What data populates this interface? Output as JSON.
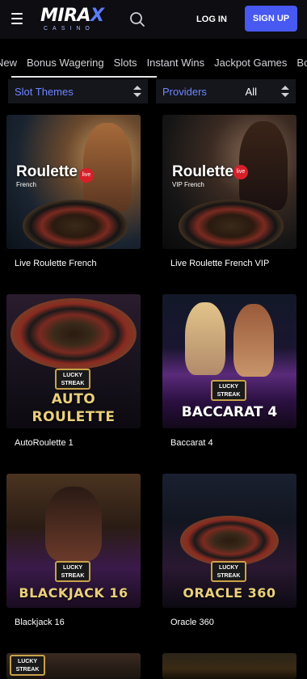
{
  "header": {
    "logo_main_a": "MIRA",
    "logo_main_x": "X",
    "logo_sub": "CASINO",
    "login_label": "LOG IN",
    "signup_label": "SIGN UP",
    "menu_icon": "hamburger-icon",
    "search_icon": "search-icon",
    "accent_color": "#4759f0"
  },
  "categories": [
    "New",
    "Bonus Wagering",
    "Slots",
    "Instant Wins",
    "Jackpot Games",
    "Bo"
  ],
  "filters": {
    "themes_label": "Slot Themes",
    "providers_label": "Providers",
    "providers_value": "All"
  },
  "games": [
    {
      "title": "Live Roulette French",
      "art_title": "Roulette",
      "art_sub": "French",
      "badge": "live"
    },
    {
      "title": "Live Roulette French VIP",
      "art_title": "Roulette",
      "art_sub": "VIP French",
      "badge": "live"
    },
    {
      "title": "AutoRoulette 1",
      "art_line1": "AUTO",
      "art_line2": "ROULETTE",
      "brand": "LUCKY STREAK"
    },
    {
      "title": "Baccarat 4",
      "art_line1": "BACCARAT 4",
      "brand": "LUCKY STREAK"
    },
    {
      "title": "Blackjack 16",
      "art_line1": "BLACKJACK 16",
      "brand": "LUCKY STREAK"
    },
    {
      "title": "Oracle 360",
      "art_line1": "ORACLE 360",
      "brand": "LUCKY STREAK"
    },
    {
      "title": "",
      "brand": "LUCKY STREAK"
    },
    {
      "title": ""
    }
  ]
}
